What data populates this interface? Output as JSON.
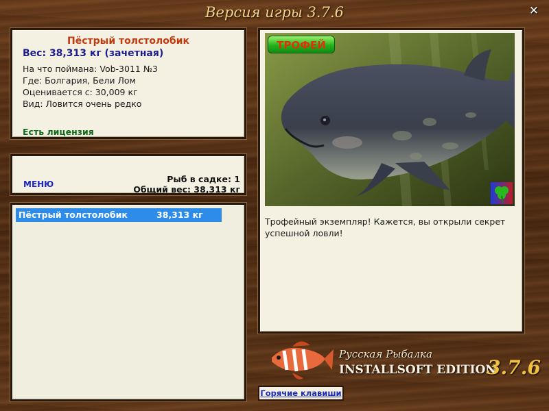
{
  "window": {
    "title": "Версия игры 3.7.6",
    "close_icon": "close-icon"
  },
  "catch_info": {
    "fish_name": "Пёстрый толстолобик",
    "weight": "Вес: 38,313 кг (зачетная)",
    "bait": "На что поймана: Vob-3011 №3",
    "location": "Где: Болгария, Бели Лом",
    "valued_from": "Оценивается с: 30,009 кг",
    "kind": "Вид: Ловится очень редко",
    "license": "Есть лицензия"
  },
  "menu": {
    "label": "МЕНЮ",
    "fish_in_keepnet": "Рыб в садке: 1",
    "total_weight": "Общий вес: 38,313 кг"
  },
  "keepnet": {
    "rows": [
      {
        "name": "Пёстрый толстолобик",
        "weight": "38,313 кг"
      }
    ]
  },
  "trophy": {
    "badge": "ТРОФЕЙ",
    "description": "Трофейный экземпляр! Кажется, вы открыли секрет успешной ловли!",
    "corner_icon": "clover-icon"
  },
  "logo": {
    "line1": "Русская Рыбалка",
    "line2": "INSTALLSOFT EDITION",
    "version": "3.7.6"
  },
  "hotkeys": {
    "label": "Горячие клавиши"
  },
  "colors": {
    "wood": "#5a3418",
    "panel": "#f4f1e3",
    "selection": "#2d8bea",
    "fish_name": "#c03a10",
    "weight": "#1b1d8a",
    "license": "#0f6a1a"
  }
}
